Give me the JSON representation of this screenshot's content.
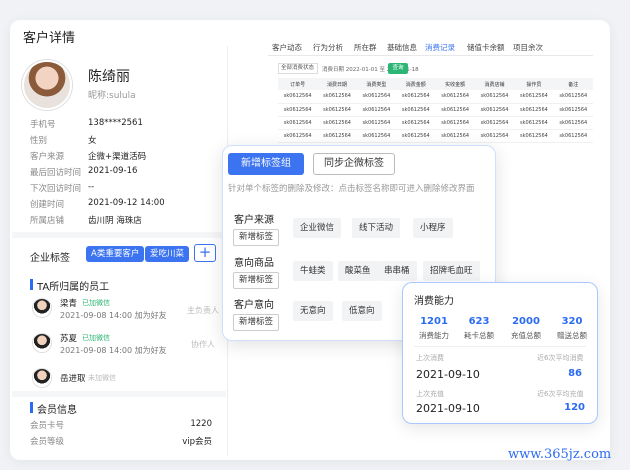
{
  "page_title": "客户详情",
  "profile": {
    "name": "陈绮丽",
    "nickname": "昵称:sulula"
  },
  "info": [
    {
      "label": "手机号",
      "value": "138****2561"
    },
    {
      "label": "性别",
      "value": "女"
    },
    {
      "label": "客户来源",
      "value": "企微+渠道活码"
    },
    {
      "label": "最后回访时间",
      "value": "2021-09-16"
    },
    {
      "label": "下次回访时间",
      "value": "--"
    },
    {
      "label": "创建时间",
      "value": "2021-09-12 14:00"
    },
    {
      "label": "所属店铺",
      "value": "齿川阴 海珠店"
    }
  ],
  "enterprise_tags": {
    "title": "企业标签",
    "tags": [
      "A类重要客户",
      "爱吃川菜"
    ],
    "add": "+"
  },
  "employees": {
    "title": "TA所归属的员工",
    "list": [
      {
        "name": "梁青",
        "badge": "已加微信",
        "sub": "2021-09-08 14:00 加为好友",
        "role": "主负责人"
      },
      {
        "name": "苏夏",
        "badge": "已加微信",
        "sub": "2021-09-08 14:00 加为好友",
        "role": "协作人"
      },
      {
        "name": "岳进取",
        "badge": "未加微信",
        "sub": "",
        "role": ""
      }
    ]
  },
  "member": {
    "title": "会员信息",
    "rows": [
      {
        "label": "会员卡号",
        "value": "1220"
      },
      {
        "label": "会员等级",
        "value": "vip会员"
      }
    ]
  },
  "tabs": [
    "客户动态",
    "行为分析",
    "所在群",
    "基础信息",
    "消费记录",
    "储值卡余额",
    "项目余次"
  ],
  "active_tab": "消费记录",
  "filter": {
    "select": "全部消费状态",
    "range": "消费日期  2022-01-01 至  2022-01-18",
    "query": "查询"
  },
  "orders": {
    "headers": [
      "订单号",
      "消费日期",
      "消费类型",
      "消费金额",
      "实收金额",
      "消费店铺",
      "操作员",
      "备注"
    ],
    "rows": [
      [
        "sk0612564",
        "sk0612564",
        "sk0612564",
        "sk0612564",
        "sk0612564",
        "sk0612564",
        "sk0612564",
        "sk0612564"
      ],
      [
        "sk0612564",
        "sk0612564",
        "sk0612564",
        "sk0612564",
        "sk0612564",
        "sk0612564",
        "sk0612564",
        "sk0612564"
      ],
      [
        "sk0612564",
        "sk0612564",
        "sk0612564",
        "sk0612564",
        "sk0612564",
        "sk0612564",
        "sk0612564",
        "sk0612564"
      ],
      [
        "sk0612564",
        "sk0612564",
        "sk0612564",
        "sk0612564",
        "sk0612564",
        "sk0612564",
        "sk0612564",
        "sk0612564"
      ]
    ]
  },
  "tag_popup": {
    "btn_new": "新增标签组",
    "btn_sync": "同步企微标签",
    "hint": "针对单个标签的删除及修改：点击标签名称即可进入删除修改界面",
    "add_tag": "新增标签",
    "groups": [
      {
        "label": "客户来源",
        "chips": [
          "企业微信",
          "线下活动",
          "小程序"
        ]
      },
      {
        "label": "意向商品",
        "chips": [
          "牛蛙类",
          "酸菜鱼",
          "串串桶",
          "招牌毛血旺"
        ]
      },
      {
        "label": "客户意向",
        "chips": [
          "无意向",
          "低意向"
        ]
      }
    ]
  },
  "consumption": {
    "title": "消费能力",
    "stats": [
      {
        "value": "1201",
        "label": "消费能力"
      },
      {
        "value": "623",
        "label": "耗卡总额"
      },
      {
        "value": "2000",
        "label": "充值总额"
      },
      {
        "value": "320",
        "label": "赠送总额"
      }
    ],
    "last_consume_label": "上次消费",
    "last_consume_date": "2021-09-10",
    "avg_consume_label": "近6次平均消费",
    "avg_consume_value": "86",
    "last_recharge_label": "上次充值",
    "last_recharge_date": "2021-09-10",
    "avg_recharge_label": "近6次平均充值",
    "avg_recharge_value": "120"
  },
  "watermark": "www.365jz.com"
}
